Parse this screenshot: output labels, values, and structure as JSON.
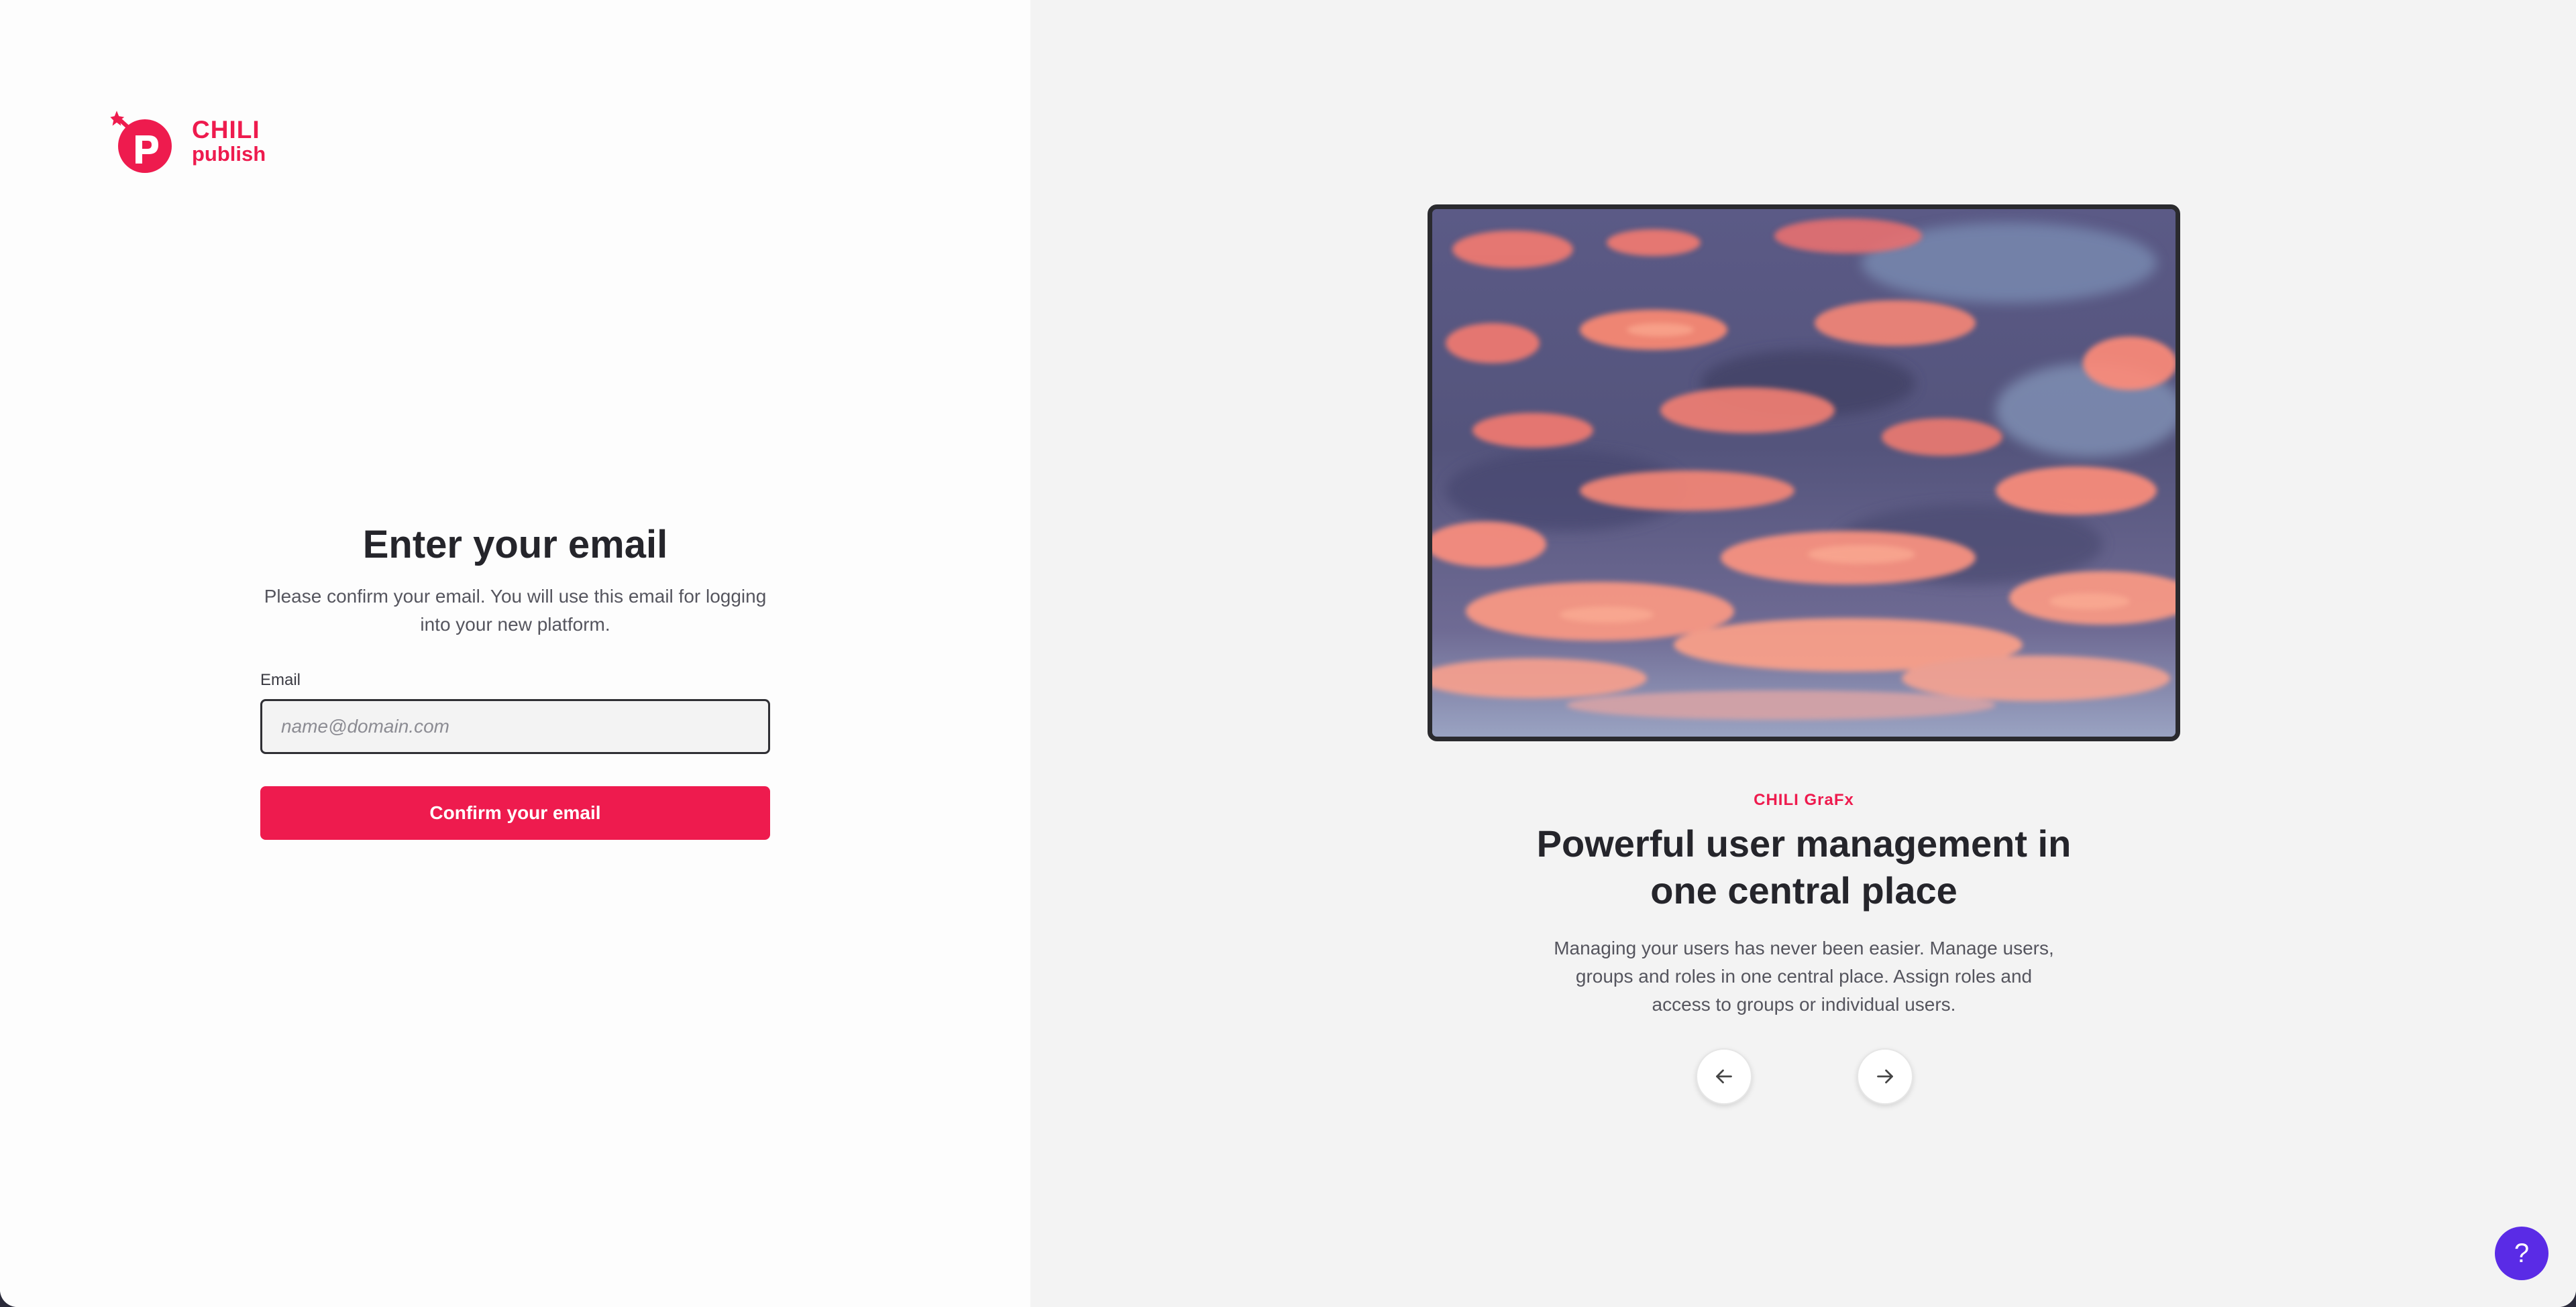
{
  "brand": {
    "name_line1": "CHILI",
    "name_line2": "publish",
    "color": "#ee1b4e"
  },
  "form": {
    "title": "Enter your email",
    "subtitle": "Please confirm your email. You will use this email for logging into your new platform.",
    "email_label": "Email",
    "email_placeholder": "name@domain.com",
    "email_value": "",
    "submit_label": "Confirm your email"
  },
  "slide": {
    "image": "sunset-clouds-sky",
    "eyebrow": "CHILI GraFx",
    "title": "Powerful user management in one central place",
    "description": "Managing your users has never been easier. Manage users, groups and roles in one central place. Assign roles and access to groups or individual users.",
    "prev_icon": "arrow-left-icon",
    "next_icon": "arrow-right-icon"
  },
  "help": {
    "icon": "question-mark-icon",
    "label": "?",
    "color": "#5a2be6"
  }
}
